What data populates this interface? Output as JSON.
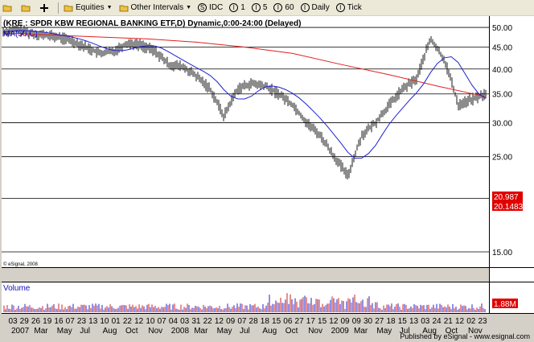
{
  "toolbar": {
    "equities": "Equities",
    "intervals": "Other Intervals",
    "idc": "IDC",
    "one": "1",
    "five": "5",
    "sixty": "60",
    "daily": "Daily",
    "tick": "Tick"
  },
  "chart_data": {
    "type": "line",
    "title": "(KRE : SPDR KBW REGIONAL BANKING ETF,D) Dynamic,0:00-24:00 (Delayed)",
    "ma_label": "MA(50,C)",
    "watermark": "© eSignal, 2008",
    "publisher": "Published by eSignal - www.esignal.com",
    "volume_label": "Volume",
    "volume_value": "1.88M",
    "last_price": "20.987",
    "ma_value": "20.1483",
    "ylim": [
      14,
      52
    ],
    "y_ticks": [
      15,
      20,
      25,
      30,
      35,
      40,
      45,
      50
    ],
    "y_tick_labels": [
      "15.00",
      "",
      "25.00",
      "30.00",
      "35.00",
      "40.00",
      "45.00",
      "50.00"
    ],
    "x_day_labels": [
      "03",
      "29",
      "26",
      "19",
      "16",
      "07",
      "23",
      "13",
      "10",
      "01",
      "22",
      "12",
      "10",
      "07",
      "04",
      "03",
      "31",
      "22",
      "12",
      "09",
      "07",
      "28",
      "18",
      "15",
      "06",
      "27",
      "17",
      "15",
      "12",
      "09",
      "09",
      "30",
      "27",
      "18",
      "15",
      "13",
      "03",
      "24",
      "21",
      "12",
      "02",
      "23"
    ],
    "x_period_labels": [
      "2007",
      "Mar",
      "May",
      "Jul",
      "Aug",
      "Oct",
      "Nov",
      "2008",
      "Mar",
      "May",
      "Jul",
      "Aug",
      "Oct",
      "Nov",
      "2009",
      "Mar",
      "May",
      "Jul",
      "Aug",
      "Oct",
      "Nov"
    ],
    "series": [
      {
        "name": "Price",
        "x": [
          0,
          3,
          6,
          9,
          12,
          15,
          18,
          21,
          24,
          27,
          30,
          33,
          36,
          39,
          42,
          45,
          48,
          51,
          54,
          57,
          60,
          63,
          66,
          69,
          72,
          75,
          78,
          81,
          84,
          87,
          90,
          93,
          96,
          99,
          102,
          105
        ],
        "values": [
          48.8,
          49.5,
          48.5,
          48.0,
          47.5,
          46.5,
          45.0,
          43.5,
          44.0,
          46.0,
          45.5,
          44.0,
          41.0,
          40.5,
          38.5,
          36.0,
          31.0,
          36.0,
          37.0,
          36.5,
          35.0,
          33.0,
          30.0,
          28.0,
          25.0,
          22.5,
          28.0,
          30.0,
          33.0,
          36.0,
          38.0,
          47.0,
          42.0,
          33.0,
          34.0,
          35.0
        ]
      },
      {
        "name": "MA",
        "x": [
          0,
          10,
          20,
          30,
          40,
          50,
          60,
          70,
          80,
          90,
          100
        ],
        "values": [
          48.5,
          48.0,
          47.5,
          47.0,
          46.2,
          45.0,
          43.5,
          41.0,
          38.8,
          36.5,
          34.5
        ]
      }
    ]
  }
}
